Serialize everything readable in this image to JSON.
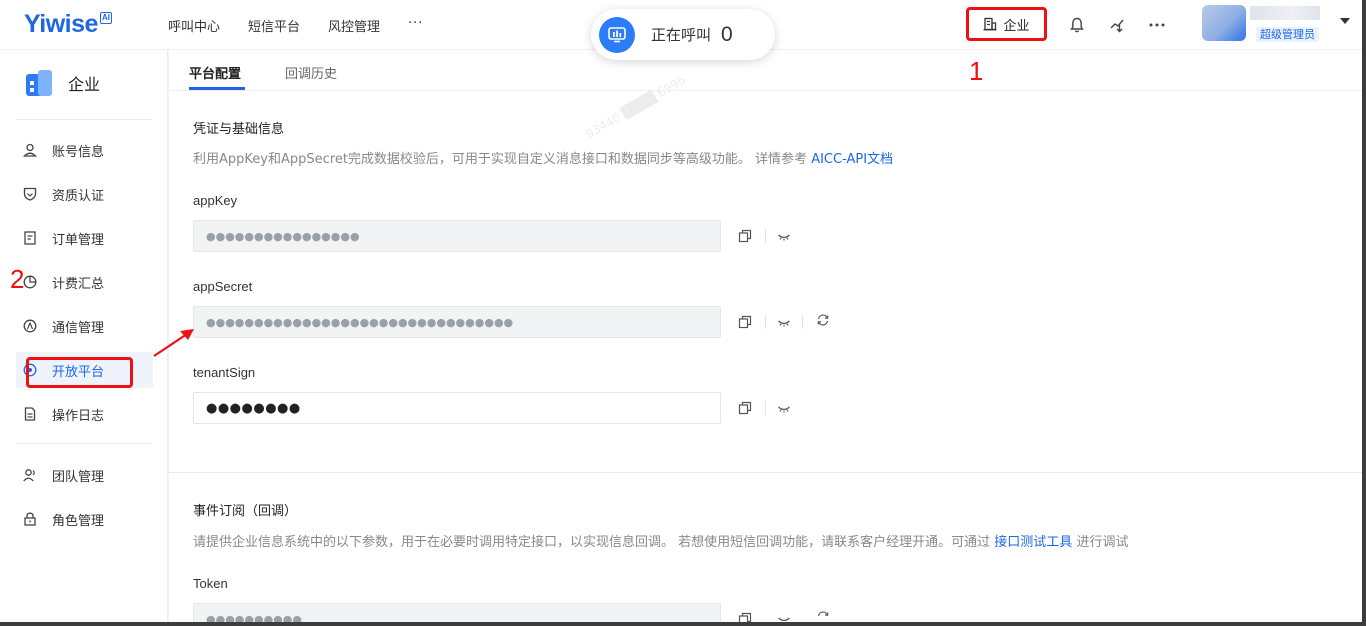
{
  "app": {
    "logo": "Yiwise",
    "logo_badge": "AI"
  },
  "topnav": {
    "items": [
      "呼叫中心",
      "短信平台",
      "风控管理"
    ],
    "more": "···"
  },
  "call_status": {
    "label": "正在呼叫",
    "count": "0"
  },
  "header": {
    "enterprise_label": "企业",
    "role": "超级管理员"
  },
  "annotations": {
    "one": "1",
    "two": "2"
  },
  "sidebar": {
    "title": "企业",
    "items": [
      {
        "label": "账号信息",
        "icon": "user-icon"
      },
      {
        "label": "资质认证",
        "icon": "shield-icon"
      },
      {
        "label": "订单管理",
        "icon": "document-icon"
      },
      {
        "label": "计费汇总",
        "icon": "pie-chart-icon"
      },
      {
        "label": "通信管理",
        "icon": "signal-icon"
      },
      {
        "label": "开放平台",
        "icon": "open-platform-icon",
        "active": true
      },
      {
        "label": "操作日志",
        "icon": "log-icon"
      },
      {
        "label": "团队管理",
        "icon": "team-icon"
      },
      {
        "label": "角色管理",
        "icon": "lock-icon"
      }
    ]
  },
  "tabs": [
    {
      "label": "平台配置",
      "active": true
    },
    {
      "label": "回调历史",
      "active": false
    }
  ],
  "credentials": {
    "title": "凭证与基础信息",
    "desc": "利用AppKey和AppSecret完成数据校验后，可用于实现自定义消息接口和数据同步等高级功能。 详情参考",
    "link": "AICC-API文档",
    "fields": [
      {
        "label": "appKey",
        "value": "●●●●●●●●●●●●●●●●"
      },
      {
        "label": "appSecret",
        "value": "●●●●●●●●●●●●●●●●●●●●●●●●●●●●●●●●"
      },
      {
        "label": "tenantSign",
        "value": "●●●●●●●●"
      }
    ]
  },
  "events": {
    "title": "事件订阅（回调）",
    "desc": "请提供企业信息系统中的以下参数，用于在必要时调用特定接口，以实现信息回调。 若想使用短信回调功能，请联系客户经理开通。可通过",
    "link": "接口测试工具",
    "desc_tail": "进行调试",
    "token_label": "Token",
    "token_value": "●●●●●●●●●●"
  },
  "colors": {
    "accent": "#1f66e6",
    "annotation": "#ee1111"
  }
}
